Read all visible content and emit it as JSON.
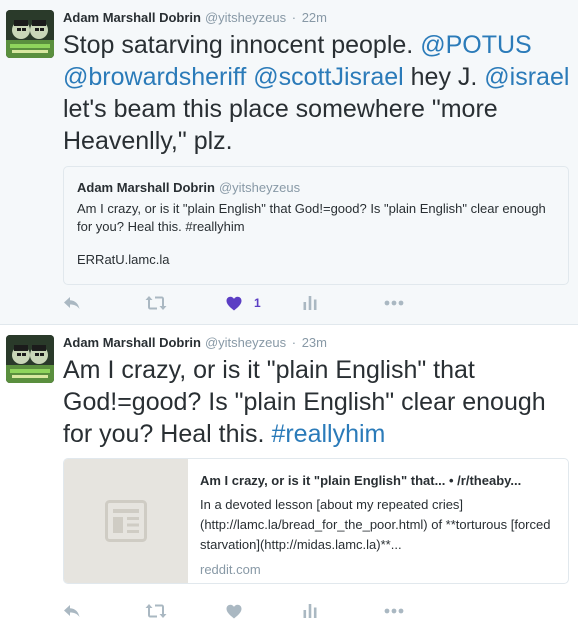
{
  "colors": {
    "link": "#2b7bb9",
    "muted": "#8899a6",
    "text": "#292f33",
    "like_active": "#5b3ec4",
    "icon": "#aab8c2"
  },
  "tweets": [
    {
      "author": {
        "fullname": "Adam Marshall Dobrin",
        "username": "@yitsheyzeus"
      },
      "separator": "·",
      "time": "22m",
      "text": {
        "t1": "Stop satarving innocent people. ",
        "m1": "@POTUS",
        "sp1": " ",
        "m2": "@browardsheriff",
        "sp2": " ",
        "m3": "@scottJisrael",
        "t2": " hey J. ",
        "m4": "@israel",
        "t3": "  let's beam this place somewhere \"more Heavenlly,\" plz."
      },
      "quote": {
        "fullname": "Adam Marshall Dobrin",
        "username": "@yitsheyzeus",
        "text": "Am I crazy, or is it \"plain English\" that God!=good? Is \"plain English\" clear enough for you? Heal this. #reallyhim",
        "link": "ERRatU.lamc.la"
      },
      "actions": {
        "reply_icon": "reply-icon",
        "retweet_icon": "retweet-icon",
        "like_icon": "heart-icon",
        "like_count": "1",
        "liked": true,
        "analytics_icon": "analytics-icon",
        "more_icon": "more-icon"
      }
    },
    {
      "author": {
        "fullname": "Adam Marshall Dobrin",
        "username": "@yitsheyzeus"
      },
      "separator": "·",
      "time": "23m",
      "text": {
        "t1": "Am I crazy, or is it \"plain English\" that God!=good? Is \"plain English\" clear enough for you? Heal this. ",
        "h1": "#reallyhim"
      },
      "card": {
        "title": "Am I crazy, or is it \"plain English\" that... • /r/theaby...",
        "description": "In a devoted lesson [about my repeated cries](http://lamc.la/bread_for_the_poor.html) of **torturous [forced starvation](http://midas.lamc.la)**...",
        "domain": "reddit.com",
        "thumb_icon": "article-icon"
      },
      "actions": {
        "reply_icon": "reply-icon",
        "retweet_icon": "retweet-icon",
        "like_icon": "heart-icon",
        "liked": false,
        "analytics_icon": "analytics-icon",
        "more_icon": "more-icon"
      }
    }
  ]
}
